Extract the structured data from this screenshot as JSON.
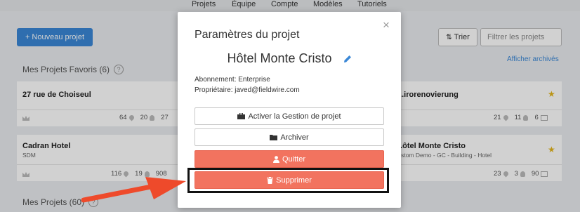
{
  "topnav": {
    "items": [
      "Projets",
      "Équipe",
      "Compte",
      "Modèles",
      "Tutoriels"
    ]
  },
  "page": {
    "new_project_label": "+ Nouveau projet",
    "sort_label": "Trier",
    "filter_placeholder": "Filtrer les projets",
    "favorites_title": "Mes Projets Favoris (6)",
    "archived_link": "Afficher archivés",
    "my_projects_title": "Mes Projets (60)",
    "help_glyph": "?"
  },
  "cards": [
    {
      "title": "27 rue de Choiseul",
      "subtitle": "",
      "stats": [
        "64",
        "20",
        "27"
      ]
    },
    {
      "title": "...irorenovierung",
      "subtitle": "",
      "stats": [
        "21",
        "11",
        "6"
      ],
      "starred": true
    },
    {
      "title": "Cadran Hotel",
      "subtitle": "SDM",
      "stats": [
        "116",
        "19",
        "908"
      ]
    },
    {
      "title": "...ôtel Monte Cristo",
      "subtitle": "...stom Demo - GC - Building - Hotel",
      "stats": [
        "23",
        "3",
        "90"
      ],
      "starred": true
    }
  ],
  "modal": {
    "title": "Paramètres du projet",
    "close_glyph": "×",
    "project_name": "Hôtel Monte Cristo",
    "subscription": "Abonnement: Enterprise",
    "owner": "Propriétaire: javed@fieldwire.com",
    "buttons": {
      "activate": "Activer la Gestion de projet",
      "archive": "Archiver",
      "quit": "Quitter",
      "delete": "Supprimer"
    }
  },
  "colors": {
    "primary_blue": "#3a87d6",
    "danger_red": "#f2735f",
    "star_yellow": "#e3b51b",
    "arrow_red": "#ee4a2b"
  }
}
